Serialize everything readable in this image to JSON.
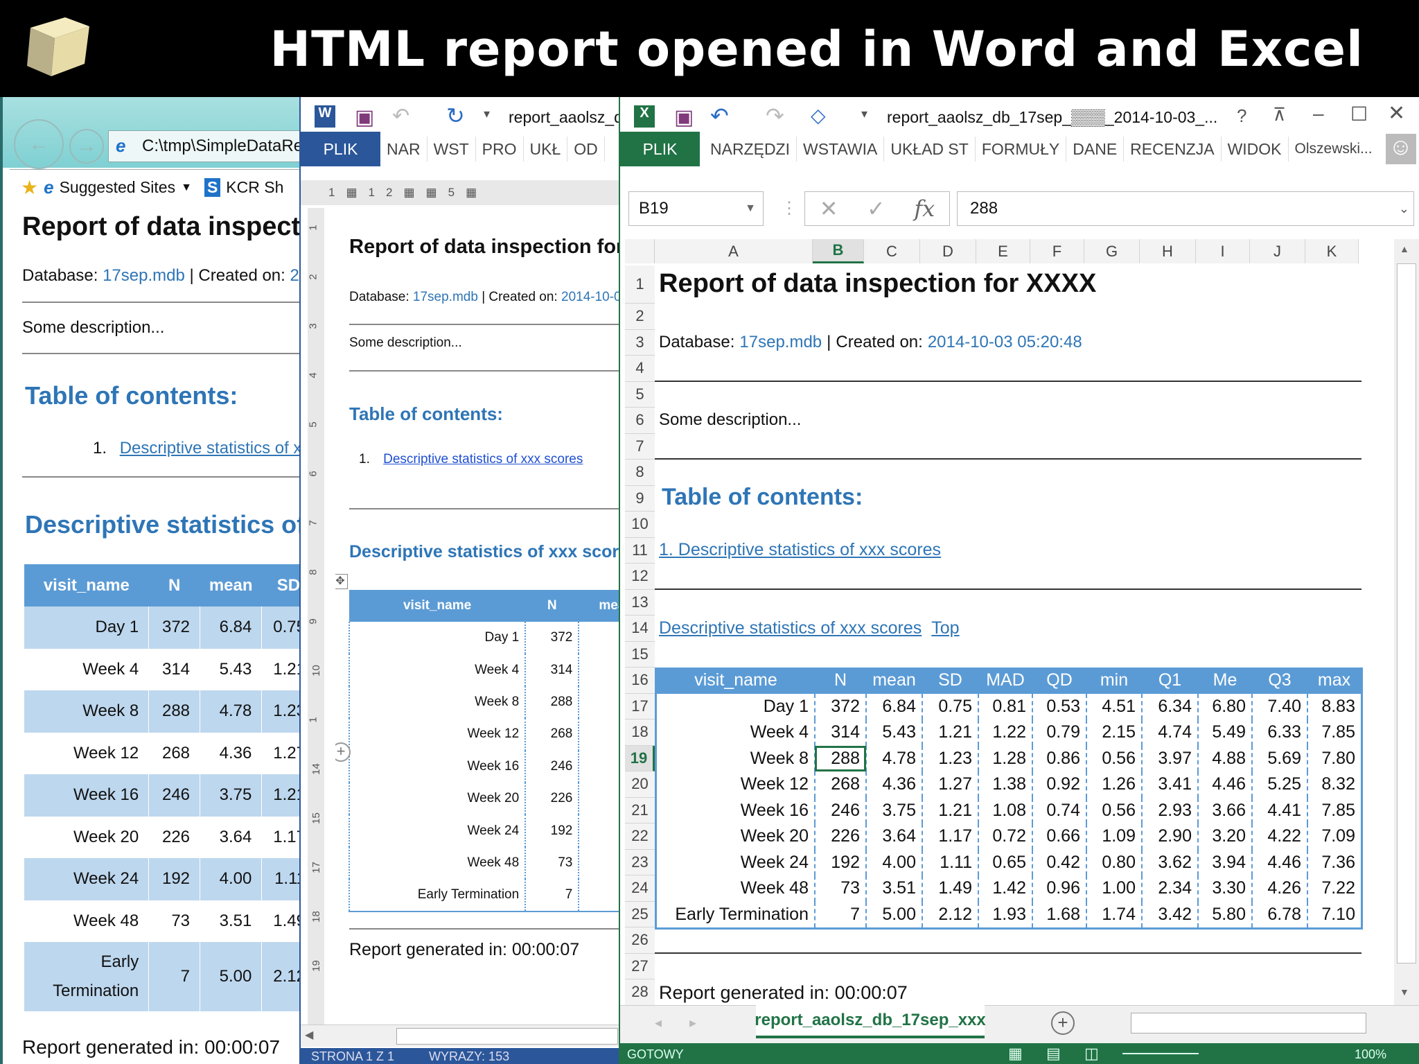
{
  "banner": {
    "title": "HTML report opened in Word and Excel"
  },
  "report": {
    "title": "Report of data inspection for XXXX",
    "database_label": "Database:",
    "database_name": "17sep.mdb",
    "separator": "|",
    "created_label": "Created on:",
    "created_value": "2014-10-03 05:20:48",
    "description": "Some description...",
    "toc_heading": "Table of contents:",
    "toc_number": "1.",
    "toc_item": "Descriptive statistics of xxx scores",
    "toc_item_numbered": "1. Descriptive statistics of xxx scores",
    "section_heading": "Descriptive statistics of xxx scores",
    "top_link": "Top",
    "footer": "Report generated in: 00:00:07"
  },
  "table": {
    "columns": [
      "visit_name",
      "N",
      "mean",
      "SD",
      "MAD",
      "QD",
      "min",
      "Q1",
      "Me",
      "Q3",
      "max"
    ],
    "rows": [
      [
        "Day 1",
        "372",
        "6.84",
        "0.75",
        "0.81",
        "0.53",
        "4.51",
        "6.34",
        "6.80",
        "7.40",
        "8.83"
      ],
      [
        "Week 4",
        "314",
        "5.43",
        "1.21",
        "1.22",
        "0.79",
        "2.15",
        "4.74",
        "5.49",
        "6.33",
        "7.85"
      ],
      [
        "Week 8",
        "288",
        "4.78",
        "1.23",
        "1.28",
        "0.86",
        "0.56",
        "3.97",
        "4.88",
        "5.69",
        "7.80"
      ],
      [
        "Week 12",
        "268",
        "4.36",
        "1.27",
        "1.38",
        "0.92",
        "1.26",
        "3.41",
        "4.46",
        "5.25",
        "8.32"
      ],
      [
        "Week 16",
        "246",
        "3.75",
        "1.21",
        "1.08",
        "0.74",
        "0.56",
        "2.93",
        "3.66",
        "4.41",
        "7.85"
      ],
      [
        "Week 20",
        "226",
        "3.64",
        "1.17",
        "0.72",
        "0.66",
        "1.09",
        "2.90",
        "3.20",
        "4.22",
        "7.09"
      ],
      [
        "Week 24",
        "192",
        "4.00",
        "1.11",
        "0.65",
        "0.42",
        "0.80",
        "3.62",
        "3.94",
        "4.46",
        "7.36"
      ],
      [
        "Week 48",
        "73",
        "3.51",
        "1.49",
        "1.42",
        "0.96",
        "1.00",
        "2.34",
        "3.30",
        "4.26",
        "7.22"
      ],
      [
        "Early Termination",
        "7",
        "5.00",
        "2.12",
        "1.93",
        "1.68",
        "1.74",
        "3.42",
        "5.80",
        "6.78",
        "7.10"
      ]
    ]
  },
  "ie": {
    "address": "C:\\tmp\\SimpleDataRep",
    "favorites": [
      {
        "label": "Suggested Sites"
      },
      {
        "label": "KCR Sh"
      }
    ]
  },
  "word": {
    "doc_title": "report_aaolsz_dl",
    "tabs": [
      "PLIK",
      "NAR",
      "WST",
      "PRO",
      "UKŁ",
      "OD"
    ],
    "ruler": [
      "1",
      "1",
      "2",
      "5"
    ],
    "vruler": [
      "1",
      "2",
      "3",
      "4",
      "5",
      "6",
      "7",
      "8",
      "9",
      "10",
      "1",
      "14",
      "15",
      "17",
      "18",
      "19"
    ],
    "status_page": "STRONA 1 Z 1",
    "status_words": "WYRAZY: 153"
  },
  "excel": {
    "doc_title": "report_aaolsz_db_17sep_▒▒▒_2014-10-03_...",
    "tabs": [
      "PLIK",
      "NARZĘDZI",
      "WSTAWIA",
      "UKŁAD ST",
      "FORMUŁY",
      "DANE",
      "RECENZJA",
      "WIDOK"
    ],
    "user": "Olszewski...",
    "name_box": "B19",
    "formula": "288",
    "columns": [
      "A",
      "B",
      "C",
      "D",
      "E",
      "F",
      "G",
      "H",
      "I",
      "J",
      "K"
    ],
    "selected_column": "B",
    "selected_row": "19",
    "sheet_tab": "report_aaolsz_db_17sep_xxx",
    "status": "GOTOWY",
    "zoom": "100%",
    "help": "?"
  },
  "colors": {
    "accent": "#5b9bd5",
    "heading": "#2e75b6",
    "word": "#2b579a",
    "excel": "#217346",
    "band": "#bdd7ee"
  }
}
